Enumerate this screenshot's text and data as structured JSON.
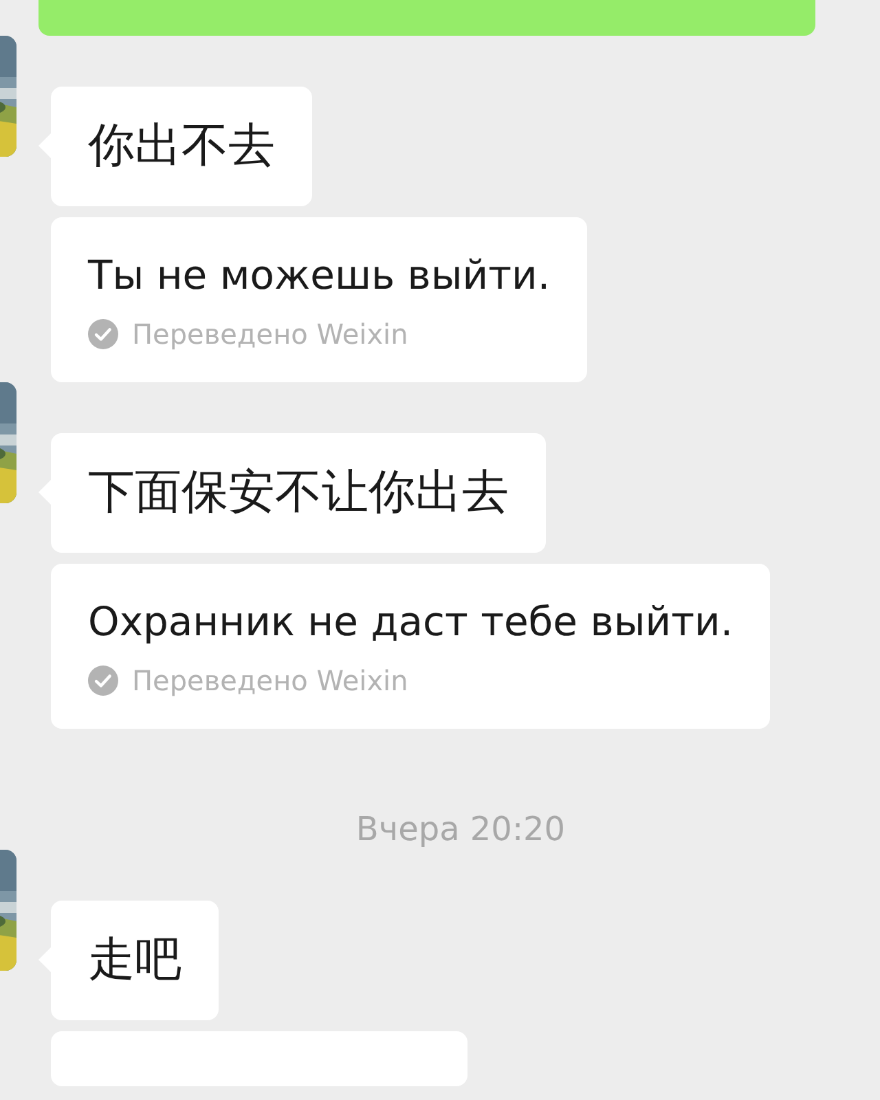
{
  "messages": [
    {
      "kind": "sent"
    },
    {
      "kind": "received",
      "text": "你出不去"
    },
    {
      "kind": "translation",
      "text": "Ты не можешь выйти.",
      "label": "Переведено Weixin"
    },
    {
      "kind": "received",
      "text": "下面保安不让你出去"
    },
    {
      "kind": "translation",
      "text": "Охранник не даст тебе выйти.",
      "label": "Переведено Weixin"
    },
    {
      "kind": "time",
      "text": "Вчера 20:20"
    },
    {
      "kind": "received",
      "text": "走吧"
    },
    {
      "kind": "translation"
    }
  ]
}
